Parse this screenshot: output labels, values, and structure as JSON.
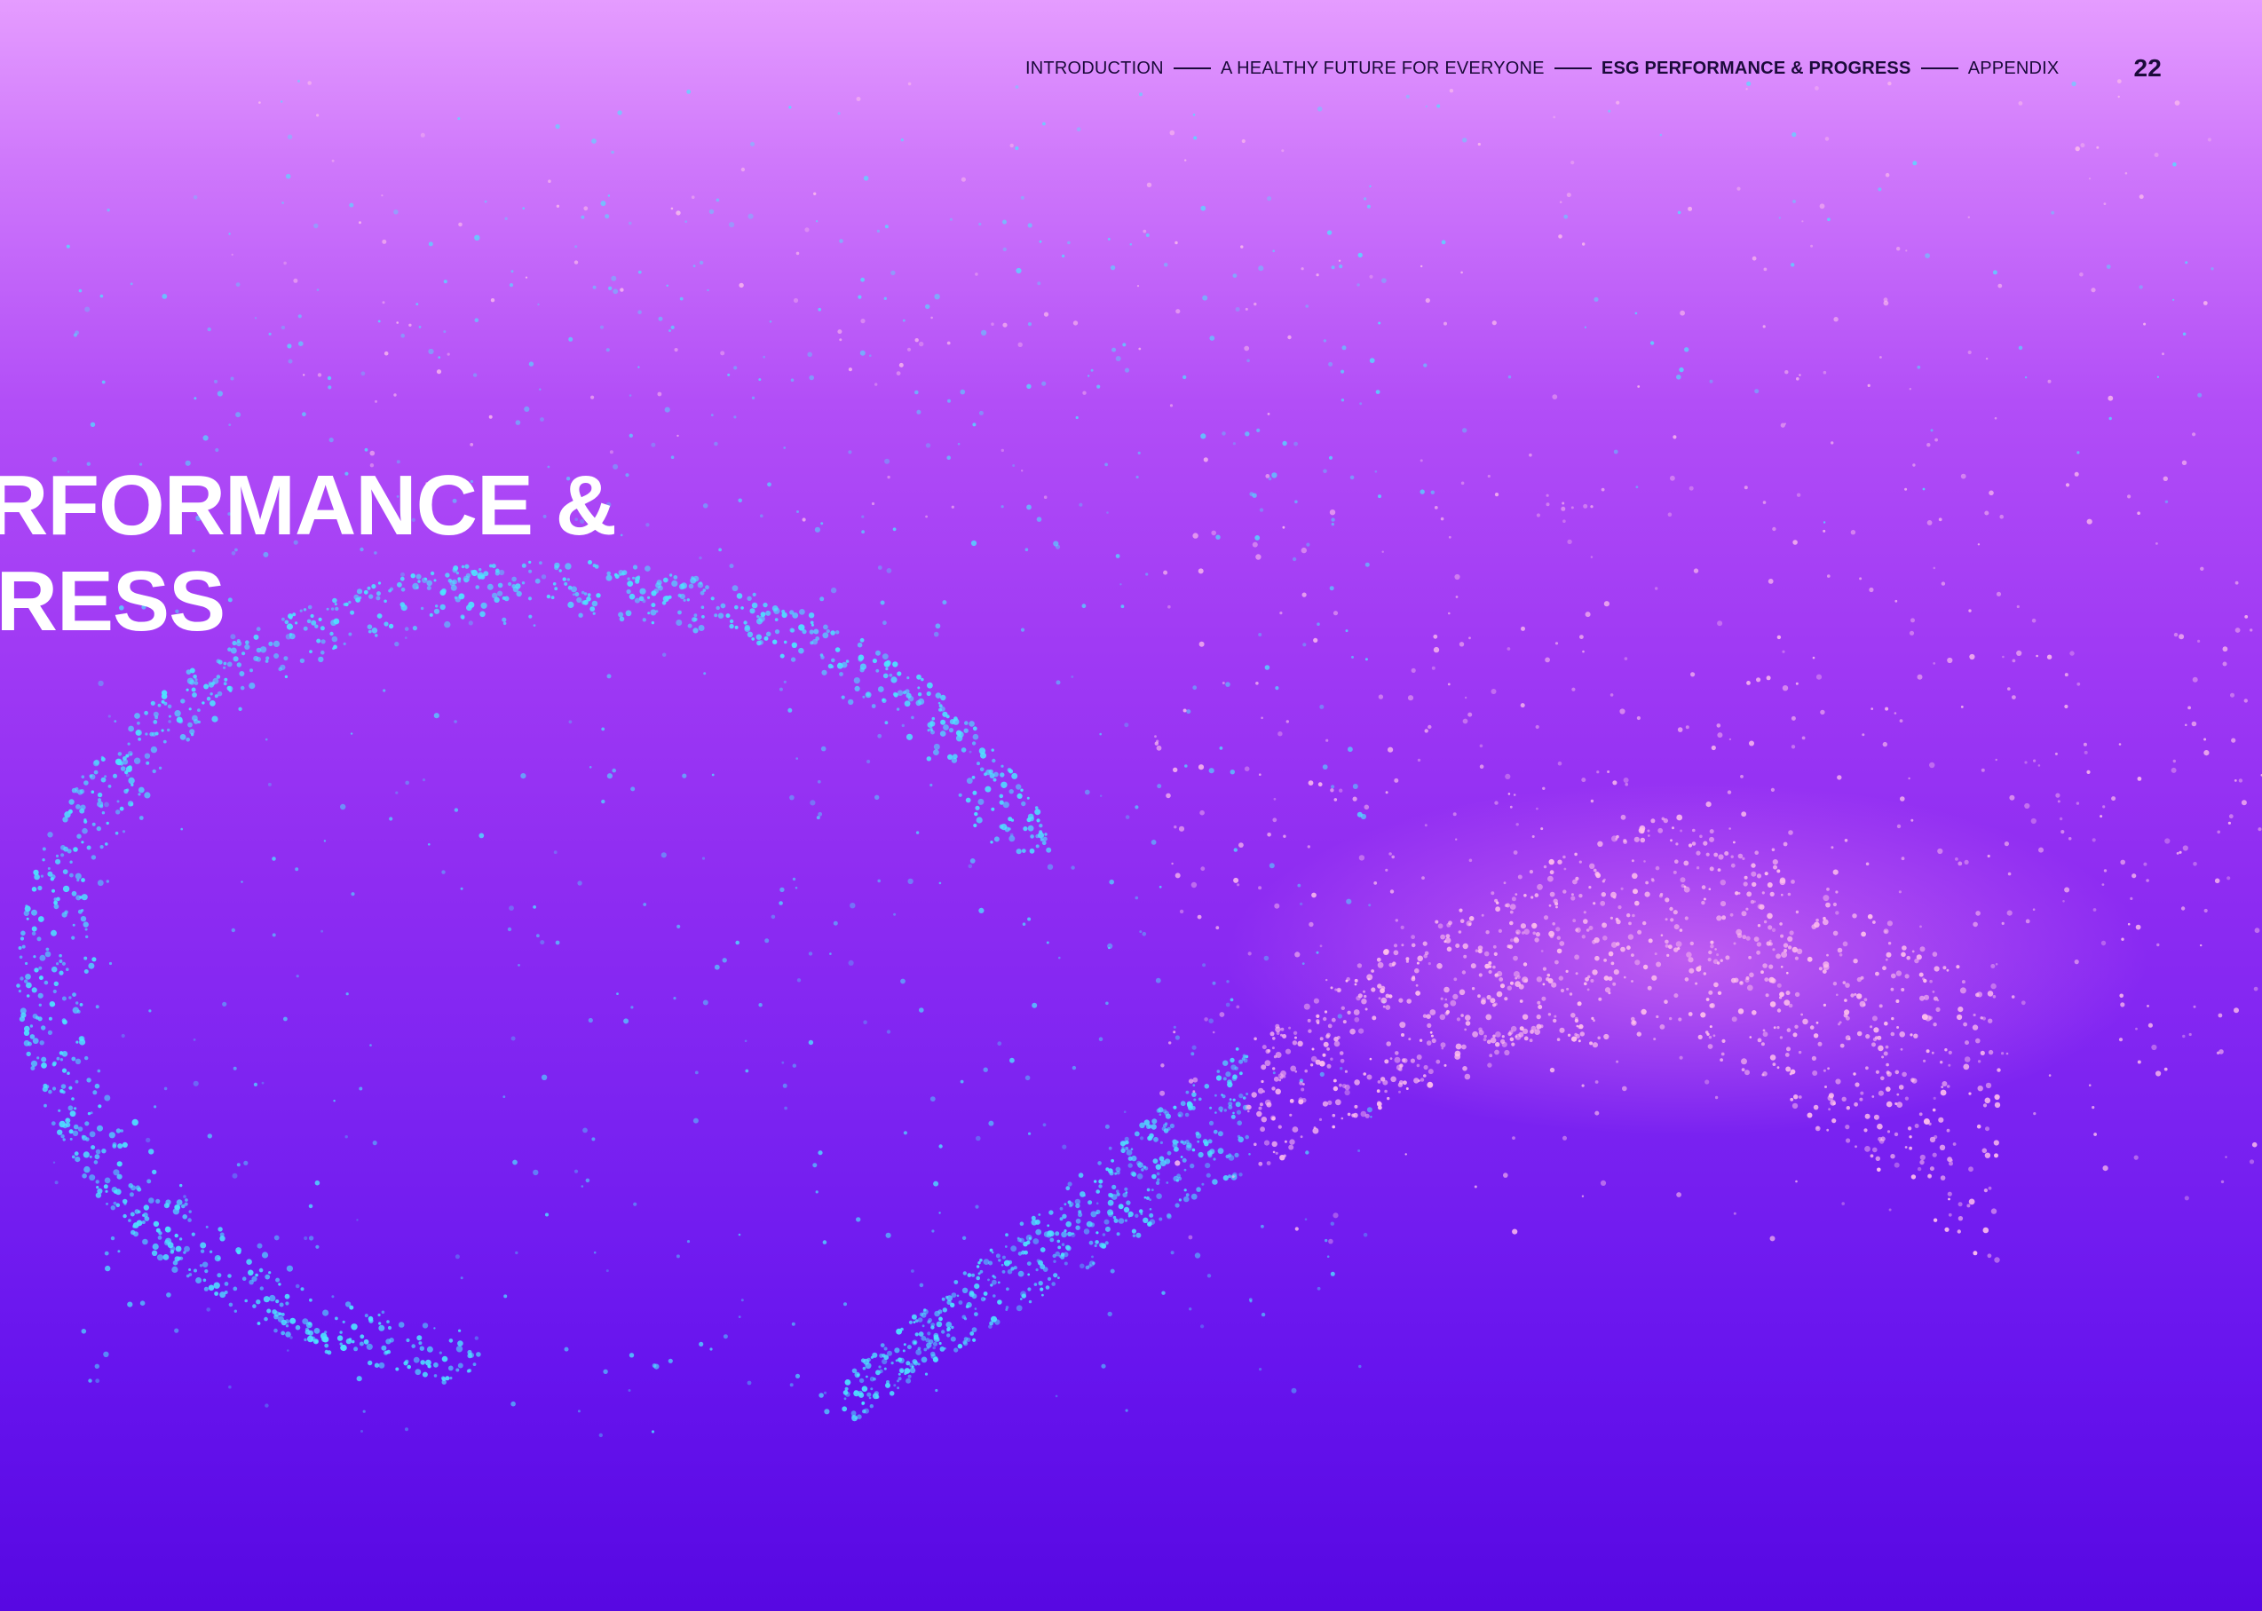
{
  "nav": {
    "items": [
      {
        "label": "INTRODUCTION",
        "active": false
      },
      {
        "label": "A HEALTHY FUTURE FOR EVERYONE",
        "active": false
      },
      {
        "label": "ESG PERFORMANCE & PROGRESS",
        "active": true
      },
      {
        "label": "APPENDIX",
        "active": false
      }
    ],
    "page_number": "22"
  },
  "hero": {
    "line1": "ERFORMANCE &",
    "line2": "GRESS"
  },
  "colors": {
    "background_top": "#e59cff",
    "background_bottom": "#5708e2",
    "particle_cyan": "#4de3ff",
    "particle_pink": "#ffc0ec",
    "text_dark": "#1b0a3a",
    "title": "#ffffff"
  }
}
